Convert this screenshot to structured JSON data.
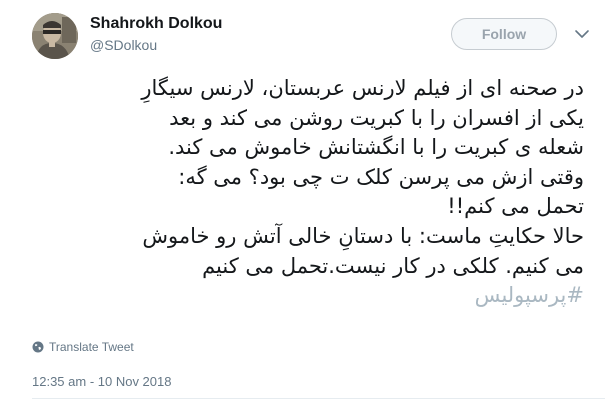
{
  "user": {
    "display_name": "Shahrokh Dolkou",
    "handle": "@SDolkou"
  },
  "follow": {
    "label": "Follow"
  },
  "tweet": {
    "lines": [
      "در صحنه ای از فیلم لارنس عربستان، لارنس سیگارِ",
      "یکی از افسران را با کبریت روشن می کند و بعد",
      "شعله ی کبریت را با انگشتانش خاموش می کند.",
      "وقتی ازش می پرسن کلک ت چی بود؟ می گه:",
      "تحمل می کنم!!",
      "حالا حکایتِ ماست: با دستانِ خالی آتش رو خاموش",
      "می کنیم. کلکی در کار نیست.تحمل می کنیم"
    ],
    "hashtag": "#پرسپولیس"
  },
  "translate": {
    "label": "Translate Tweet",
    "icon": "globe-icon"
  },
  "timestamp": "12:35 am - 10 Nov 2018",
  "colors": {
    "text": "#14171a",
    "secondary": "#657786",
    "hashtag": "#aab8c2",
    "follow_border": "#c6ccd1"
  }
}
